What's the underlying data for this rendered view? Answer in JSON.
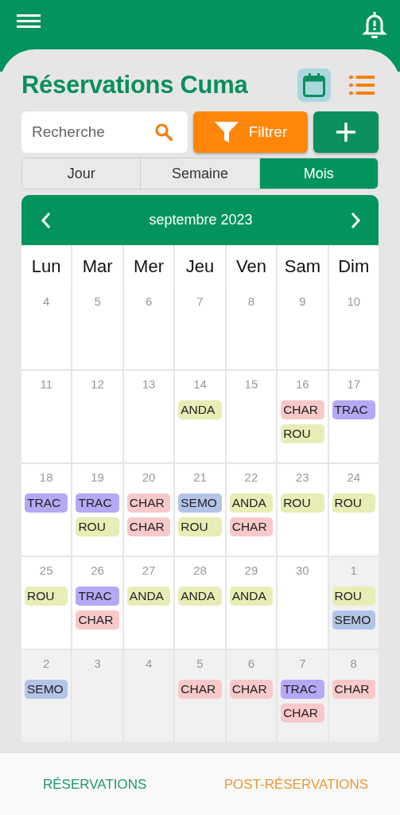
{
  "title": "Réservations Cuma",
  "view_toggle": [
    {
      "kind": "calendar",
      "selected": true
    },
    {
      "kind": "list",
      "selected": false
    }
  ],
  "search": {
    "placeholder": "Recherche"
  },
  "filter_button": "Filtrer",
  "segments": [
    {
      "label": "Jour",
      "selected": false
    },
    {
      "label": "Semaine",
      "selected": false
    },
    {
      "label": "Mois",
      "selected": true
    }
  ],
  "calendar": {
    "month": "septembre 2023",
    "weekdays": [
      "Lun",
      "Mar",
      "Mer",
      "Jeu",
      "Ven",
      "Sam",
      "Dim"
    ],
    "weeks": [
      [
        {
          "day": "4",
          "outside": false
        },
        {
          "day": "5",
          "outside": false
        },
        {
          "day": "6",
          "outside": false
        },
        {
          "day": "7",
          "outside": false
        },
        {
          "day": "8",
          "outside": false
        },
        {
          "day": "9",
          "outside": false
        },
        {
          "day": "10",
          "outside": false
        }
      ],
      [
        {
          "day": "11",
          "outside": false
        },
        {
          "day": "12",
          "outside": false
        },
        {
          "day": "13",
          "outside": false
        },
        {
          "day": "14",
          "outside": false,
          "events": [
            {
              "label": "ANDA",
              "color": "#e8edb5"
            }
          ]
        },
        {
          "day": "15",
          "outside": false
        },
        {
          "day": "16",
          "outside": false,
          "events": [
            {
              "label": "CHAR",
              "color": "#f9c9ca"
            },
            {
              "label": "ROU",
              "color": "#e8edb5"
            }
          ]
        },
        {
          "day": "17",
          "outside": false,
          "events": [
            {
              "label": "TRAC",
              "color": "#b5a8f5"
            }
          ]
        }
      ],
      [
        {
          "day": "18",
          "outside": false,
          "events": [
            {
              "label": "TRAC",
              "color": "#b5a8f5"
            }
          ]
        },
        {
          "day": "19",
          "outside": false,
          "events": [
            {
              "label": "TRAC",
              "color": "#b5a8f5"
            },
            {
              "label": "ROU",
              "color": "#e8edb5"
            }
          ]
        },
        {
          "day": "20",
          "outside": false,
          "events": [
            {
              "label": "CHAR",
              "color": "#f9c9ca"
            },
            {
              "label": "CHAR",
              "color": "#f9c9ca"
            }
          ]
        },
        {
          "day": "21",
          "outside": false,
          "events": [
            {
              "label": "SEMO",
              "color": "#b3c4e8"
            },
            {
              "label": "ROU",
              "color": "#e8edb5"
            }
          ]
        },
        {
          "day": "22",
          "outside": false,
          "events": [
            {
              "label": "ANDA",
              "color": "#e8edb5"
            },
            {
              "label": "CHAR",
              "color": "#f9c9ca"
            }
          ]
        },
        {
          "day": "23",
          "outside": false,
          "events": [
            {
              "label": "ROU",
              "color": "#e8edb5"
            }
          ]
        },
        {
          "day": "24",
          "outside": false,
          "events": [
            {
              "label": "ROU",
              "color": "#e8edb5"
            }
          ]
        }
      ],
      [
        {
          "day": "25",
          "outside": false,
          "events": [
            {
              "label": "ROU",
              "color": "#e8edb5"
            }
          ]
        },
        {
          "day": "26",
          "outside": false,
          "events": [
            {
              "label": "TRAC",
              "color": "#b5a8f5"
            },
            {
              "label": "CHAR",
              "color": "#f9c9ca"
            }
          ]
        },
        {
          "day": "27",
          "outside": false,
          "events": [
            {
              "label": "ANDA",
              "color": "#e8edb5"
            }
          ]
        },
        {
          "day": "28",
          "outside": false,
          "events": [
            {
              "label": "ANDA",
              "color": "#e8edb5"
            }
          ]
        },
        {
          "day": "29",
          "outside": false,
          "events": [
            {
              "label": "ANDA",
              "color": "#e8edb5"
            }
          ]
        },
        {
          "day": "30",
          "outside": false
        },
        {
          "day": "1",
          "outside": true,
          "events": [
            {
              "label": "ROU",
              "color": "#e8edb5"
            },
            {
              "label": "SEMO",
              "color": "#b3c4e8"
            }
          ]
        }
      ],
      [
        {
          "day": "2",
          "outside": true,
          "events": [
            {
              "label": "SEMO",
              "color": "#b3c4e8"
            }
          ]
        },
        {
          "day": "3",
          "outside": true
        },
        {
          "day": "4",
          "outside": true
        },
        {
          "day": "5",
          "outside": true,
          "events": [
            {
              "label": "CHAR",
              "color": "#f9c9ca"
            }
          ]
        },
        {
          "day": "6",
          "outside": true,
          "events": [
            {
              "label": "CHAR",
              "color": "#f9c9ca"
            }
          ]
        },
        {
          "day": "7",
          "outside": true,
          "events": [
            {
              "label": "TRAC",
              "color": "#b5a8f5"
            },
            {
              "label": "CHAR",
              "color": "#f9c9ca"
            }
          ]
        },
        {
          "day": "8",
          "outside": true,
          "events": [
            {
              "label": "CHAR",
              "color": "#f9c9ca"
            }
          ]
        }
      ]
    ]
  },
  "bottom_tabs": [
    {
      "label": "RÉSERVATIONS",
      "selected": true
    },
    {
      "label": "POST-RÉSERVATIONS",
      "selected": false
    }
  ]
}
